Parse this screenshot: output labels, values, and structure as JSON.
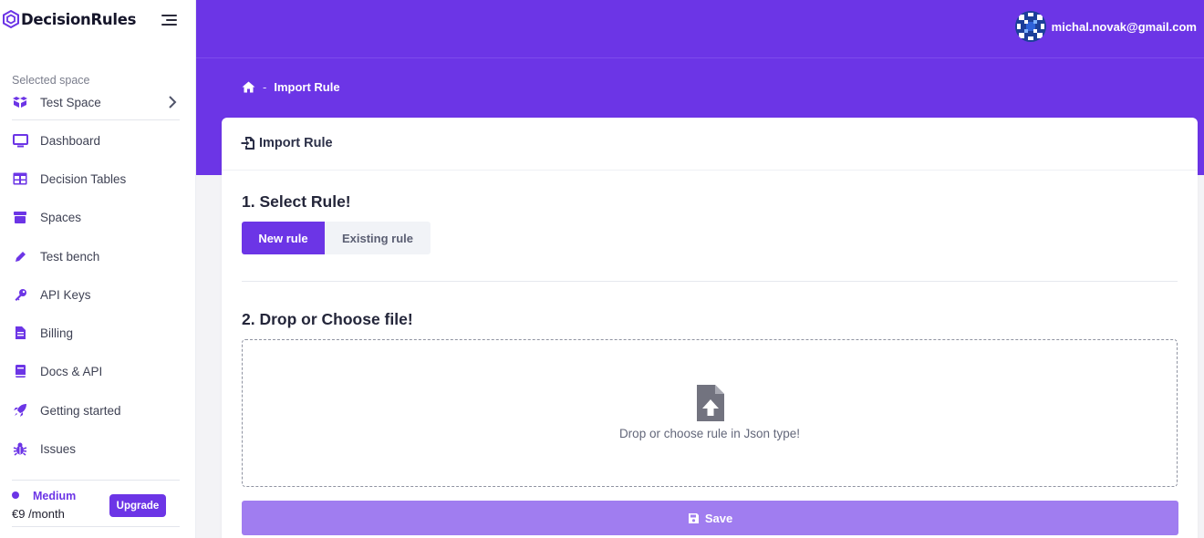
{
  "brand": {
    "name": "DecisionRules"
  },
  "sidebar": {
    "space_caption": "Selected space",
    "space_name": "Test Space",
    "items": [
      {
        "label": "Dashboard",
        "icon": "monitor-icon"
      },
      {
        "label": "Decision Tables",
        "icon": "table-icon"
      },
      {
        "label": "Spaces",
        "icon": "box-icon"
      },
      {
        "label": "Test bench",
        "icon": "pencil-icon"
      },
      {
        "label": "API Keys",
        "icon": "key-icon"
      },
      {
        "label": "Billing",
        "icon": "document-icon"
      },
      {
        "label": "Docs & API",
        "icon": "book-icon"
      },
      {
        "label": "Getting started",
        "icon": "rocket-icon"
      },
      {
        "label": "Issues",
        "icon": "bug-icon"
      }
    ],
    "plan": {
      "name": "Medium",
      "price": "€9 /month",
      "upgrade_label": "Upgrade"
    }
  },
  "header": {
    "user_email": "michal.novak@gmail.com"
  },
  "breadcrumb": {
    "separator": "-",
    "current": "Import Rule"
  },
  "card": {
    "title": "Import Rule",
    "step1_title": "1. Select Rule!",
    "new_rule_label": "New rule",
    "existing_rule_label": "Existing rule",
    "step2_title": "2. Drop or Choose file!",
    "dropzone_text": "Drop or choose rule in Json type!",
    "save_label": "Save"
  },
  "colors": {
    "accent": "#6c35e6",
    "save_disabled": "#a07df0"
  }
}
